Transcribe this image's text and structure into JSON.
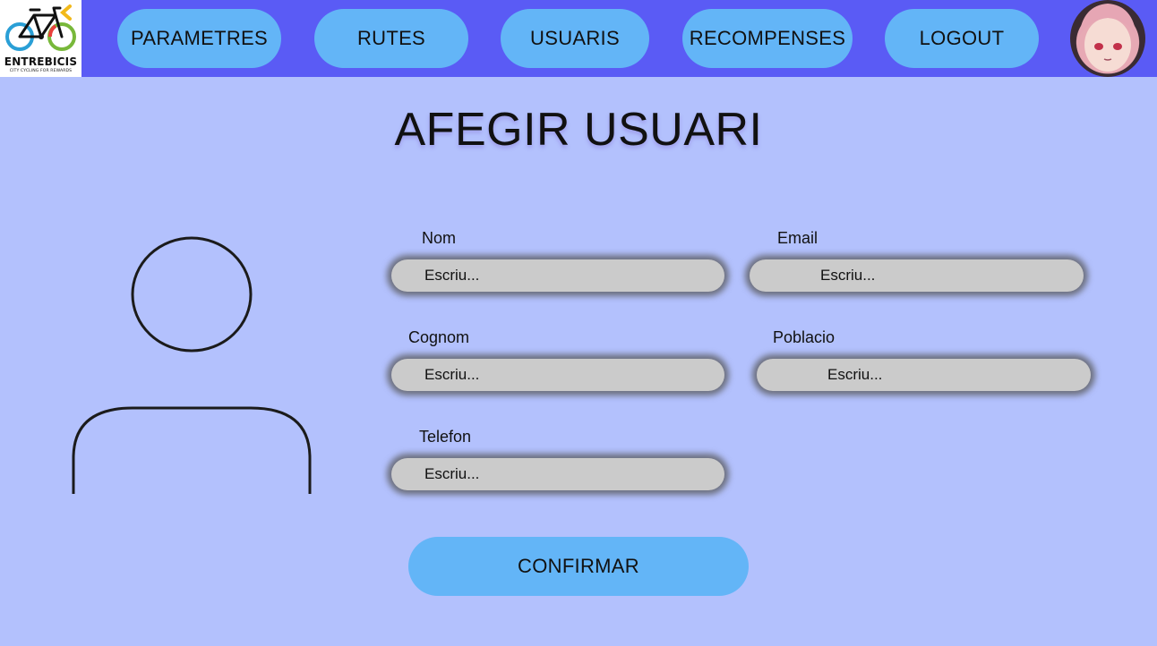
{
  "app": {
    "brand": "ENTREBICIS",
    "tagline": "CITY CYCLING FOR REWARDS"
  },
  "nav": {
    "items": [
      {
        "id": "parametres",
        "label": "PARAMETRES"
      },
      {
        "id": "rutes",
        "label": "RUTES"
      },
      {
        "id": "usuaris",
        "label": "USUARIS"
      },
      {
        "id": "recompenses",
        "label": "RECOMPENSES"
      },
      {
        "id": "logout",
        "label": "LOGOUT"
      }
    ]
  },
  "page": {
    "title": "AFEGIR USUARI"
  },
  "form": {
    "fields": [
      {
        "id": "nom",
        "label": "Nom",
        "placeholder": "Escriu..."
      },
      {
        "id": "email",
        "label": "Email",
        "placeholder": "Escriu..."
      },
      {
        "id": "cognom",
        "label": "Cognom",
        "placeholder": "Escriu..."
      },
      {
        "id": "poblacio",
        "label": "Poblacio",
        "placeholder": "Escriu..."
      },
      {
        "id": "telefon",
        "label": "Telefon",
        "placeholder": "Escriu..."
      }
    ],
    "confirm_label": "CONFIRMAR"
  },
  "colors": {
    "background": "#b3c1fd",
    "topbar": "#5a5bf5",
    "button": "#63b5f7",
    "input": "#cbcbcb"
  },
  "icons": {
    "logo": "bicycle-icon",
    "avatar_placeholder": "user-silhouette-icon"
  }
}
